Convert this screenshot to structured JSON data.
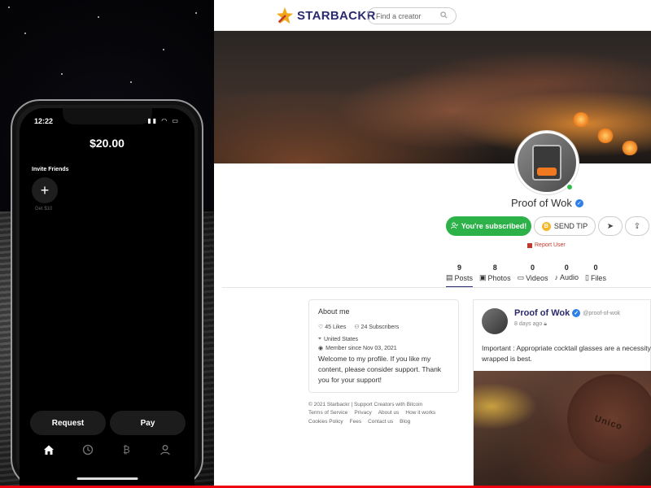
{
  "phone": {
    "status_time": "12:22",
    "balance": "$20.00",
    "invite_label": "Invite Friends",
    "invite_sub": "Get $10",
    "request_label": "Request",
    "pay_label": "Pay",
    "tabs": [
      {
        "icon": "home-icon",
        "active": true
      },
      {
        "icon": "clock-icon",
        "active": false
      },
      {
        "icon": "bitcoin-icon",
        "active": false
      },
      {
        "icon": "user-icon",
        "active": false
      }
    ]
  },
  "site": {
    "brand": "STARBACKR",
    "brand_color": "#2b2a6e",
    "search_placeholder": "Find a creator",
    "profile": {
      "name": "Proof of Wok",
      "subscribed_label": "You're subscribed!",
      "tip_label": "SEND TIP",
      "report_label": "Report User",
      "subscribed_color": "#2db24a"
    },
    "tabs": [
      {
        "count": "9",
        "label": "Posts",
        "icon": "document-icon",
        "active": true
      },
      {
        "count": "8",
        "label": "Photos",
        "icon": "image-icon",
        "active": false
      },
      {
        "count": "0",
        "label": "Videos",
        "icon": "video-icon",
        "active": false
      },
      {
        "count": "0",
        "label": "Audio",
        "icon": "mic-icon",
        "active": false
      },
      {
        "count": "0",
        "label": "Files",
        "icon": "file-icon",
        "active": false
      }
    ],
    "about": {
      "title": "About me",
      "likes": "45 Likes",
      "subscribers": "24 Subscribers",
      "location": "United States",
      "member_since": "Member since Nov 03, 2021",
      "text": "Welcome to my profile. If you like my content, please consider support. Thank you for your support!"
    },
    "footer": {
      "copyright": "© 2021 Starbackr | Support Creators with Bitcoin",
      "links": [
        "Terms of Service",
        "Privacy",
        "About us",
        "How it works",
        "Cookies Policy",
        "Fees",
        "Contact us",
        "Blog"
      ]
    },
    "post": {
      "author": "Proof of Wok",
      "handle": "@proof-of-wok",
      "date": "8 days ago",
      "text_line1": "Important : Appropriate cocktail glasses are a necessity.",
      "text_line2": "wrapped is best.",
      "image_text": "Unico"
    }
  }
}
